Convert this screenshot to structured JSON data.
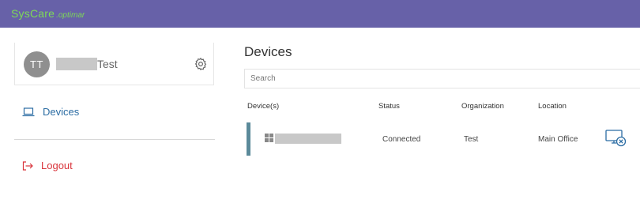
{
  "header": {
    "brand_main": "SysCare",
    "brand_sub": ".optimar",
    "brand_color": "#7ed957",
    "bar_color": "#6761a8"
  },
  "sidebar": {
    "user": {
      "initials": "TT",
      "name_suffix": "Test"
    },
    "nav": {
      "devices_label": "Devices",
      "devices_icon": "laptop-icon",
      "logout_label": "Logout",
      "logout_icon": "logout-icon"
    }
  },
  "main": {
    "title": "Devices",
    "search": {
      "placeholder": "Search",
      "value": ""
    },
    "table": {
      "headers": {
        "device": "Device(s)",
        "status": "Status",
        "organization": "Organization",
        "location": "Location"
      },
      "rows": [
        {
          "os_icon": "windows-icon",
          "status": "Connected",
          "organization": "Test",
          "location": "Main Office",
          "action_icon": "remote-connect-icon"
        }
      ]
    }
  },
  "colors": {
    "accent_blue": "#2b6ca3",
    "logout_red": "#d9343b",
    "row_accent": "#5b8a9a"
  }
}
